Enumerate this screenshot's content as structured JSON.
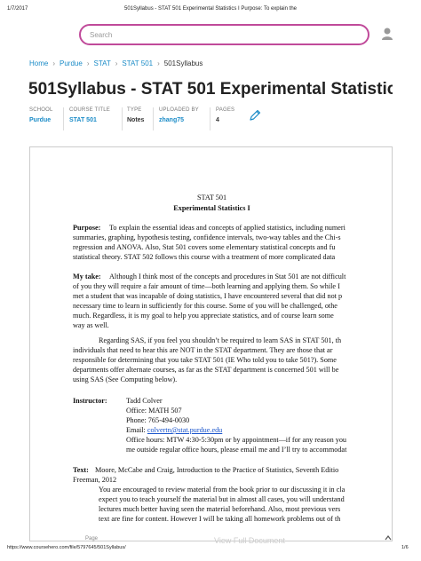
{
  "print_header": {
    "date": "1/7/2017",
    "title": "501Syllabus - STAT 501 Experimental Statistics I Purpose: To explain the"
  },
  "search": {
    "placeholder": "Search",
    "value": ""
  },
  "breadcrumb": [
    "Home",
    "Purdue",
    "STAT",
    "STAT 501",
    "501Syllabus"
  ],
  "page_title": "501Syllabus - STAT 501 Experimental Statistic...",
  "meta": {
    "school_label": "SCHOOL",
    "school": "Purdue",
    "course_label": "COURSE TITLE",
    "course": "STAT 501",
    "type_label": "TYPE",
    "type": "Notes",
    "uploaded_label": "UPLOADED BY",
    "uploaded": "zhang75",
    "pages_label": "PAGES",
    "pages": "4"
  },
  "document": {
    "heading1": "STAT 501",
    "heading2": "Experimental Statistics I",
    "purpose_label": "Purpose:",
    "purpose_lines": [
      "To explain the essential ideas and concepts of applied statistics, including numeri",
      "summaries, graphing, hypothesis testing, confidence intervals, two-way tables and the Chi-s",
      "regression and ANOVA.  Also, Stat 501 covers some elementary statistical concepts and fu",
      "statistical theory.  STAT 502 follows this course with a treatment of more complicated data"
    ],
    "take_label": "My take:",
    "take_lines": [
      "Although I think most of the concepts and procedures in Stat 501 are not difficult",
      "of you they will require a fair amount of time—both learning and applying them. So while I",
      "met a student that was incapable of doing statistics, I have encountered several that did not p",
      "necessary time to learn in sufficiently for this course.  Some of you will be challenged, othe",
      "much.  Regardless, it is my goal to help you appreciate statistics, and of course learn some",
      "way as well."
    ],
    "sas_lines": [
      "Regarding SAS, if you feel you shouldn’t be required to learn SAS in STAT 501, th",
      "individuals that need to hear this are NOT in the STAT department.  They are those that ar",
      "responsible for determining that you take STAT 501 (IE Who told you to take 501?). Some",
      "departments offer alternate courses, as far as the STAT department is concerned 501 will be",
      "using SAS (See Computing below)."
    ],
    "instructor_label": "Instructor:",
    "instructor_lines": [
      "Tadd Colver",
      "Office: MATH 507",
      "Phone: 765-494-0030",
      "Email: ",
      "Office hours:  MTW 4:30-5:30pm or by appointment—if for any reason you",
      "me outside regular office hours, please email me and I’ll try to accommodat"
    ],
    "email": "colvertn@stat.purdue.edu",
    "text_label": "Text:",
    "text_lines": [
      "Moore, McCabe and Craig, Introduction to the Practice of Statistics, Seventh Editio",
      "Freeman, 2012",
      "You are encouraged to review material from the book prior to our discussing it in cla",
      "expect you to teach yourself the material but in almost all cases, you will understand",
      "lectures much better having seen the material beforehand.  Also, most previous vers",
      "text are fine for content.  However I will be taking all homework problems out of th"
    ]
  },
  "footer": {
    "url": "https://www.coursehero.com/file/5797645/501Syllabus/",
    "page": "1/6",
    "page_label": "Page",
    "view_full": "View Full Document"
  },
  "colors": {
    "accent": "#c04a9a",
    "link": "#1a8bc7"
  },
  "icons": {
    "user": "user-icon",
    "edit": "pencil-edit-icon"
  }
}
